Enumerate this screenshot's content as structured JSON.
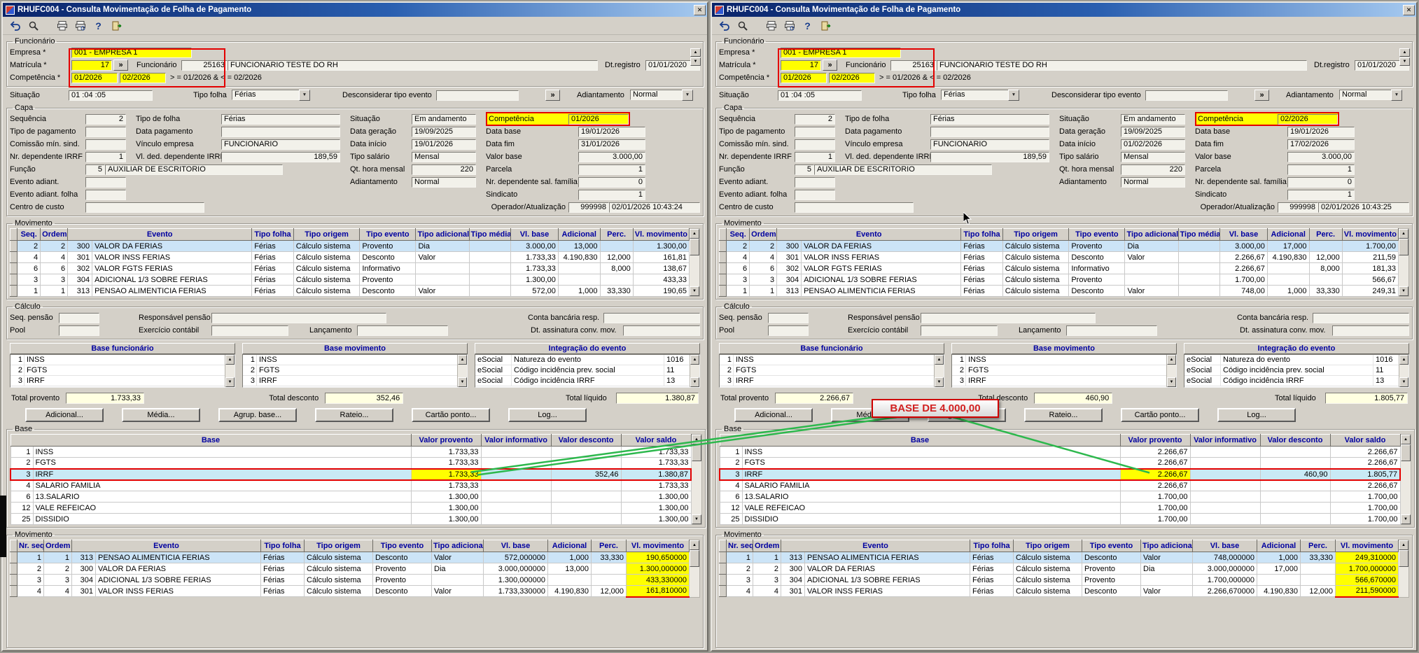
{
  "title": "RHUFC004 - Consulta Movimentação de Folha de Pagamento",
  "annotation": {
    "text": "BASE DE 4.000,00"
  },
  "icons": {
    "close": "✕",
    "dropdown": "▼",
    "more": "»",
    "up": "▲",
    "down": "▼",
    "help": "?"
  },
  "toolbar_icons": [
    "undo",
    "search",
    "print",
    "print-preview",
    "help",
    "exit"
  ],
  "labels": {
    "funcionario": "Funcionário",
    "empresa": "Empresa *",
    "matricula": "Matrícula *",
    "funcionario2": "Funcionário",
    "dt_registro": "Dt.registro",
    "competencia": "Competência *",
    "situacao": "Situação",
    "tipo_folha": "Tipo folha",
    "desconsiderar": "Desconsiderar tipo evento",
    "adiantamento": "Adiantamento",
    "capa": "Capa",
    "sequencia": "Sequência",
    "tipo_de_folha": "Tipo de folha",
    "competencia2": "Competência",
    "tipo_pagamento": "Tipo de pagamento",
    "data_pagamento": "Data pagamento",
    "data_geracao": "Data geração",
    "data_base": "Data base",
    "comissao": "Comissão mín. sind.",
    "vinculo_empresa": "Vínculo empresa",
    "data_inicio": "Data início",
    "data_fim": "Data fim",
    "nr_dep_irrf": "Nr. dependente IRRF",
    "vl_ded_irrf": "Vl. ded. dependente IRRF",
    "tipo_salario": "Tipo salário",
    "valor_base": "Valor base",
    "funcao": "Função",
    "qt_hora": "Qt. hora mensal",
    "parcela": "Parcela",
    "evento_adiant": "Evento adiant.",
    "nr_dep_sal": "Nr. dependente sal. família",
    "evento_adiant_folha": "Evento adiant. folha",
    "sindicato": "Sindicato",
    "centro_custo": "Centro de custo",
    "operador": "Operador/Atualização",
    "movimento": "Movimento",
    "mov_headers": [
      "Seq.",
      "Ordem",
      "Evento",
      "Tipo folha",
      "Tipo origem",
      "Tipo evento",
      "Tipo adicional",
      "Tipo média",
      "Vl. base",
      "Adicional",
      "Perc.",
      "Vl. movimento"
    ],
    "calculo": "Cálculo",
    "seq_pensao": "Seq. pensão",
    "resp_pensao": "Responsável pensão",
    "conta_bancaria": "Conta bancária resp.",
    "pool": "Pool",
    "exercicio": "Exercício contábil",
    "lancamento": "Lançamento",
    "dt_assinatura": "Dt. assinatura conv. mov.",
    "base_funcionario": "Base funcionário",
    "base_movimento": "Base movimento",
    "integracao": "Integração do evento",
    "total_provento": "Total provento",
    "total_desconto": "Total desconto",
    "total_liquido": "Total líquido",
    "action_buttons": [
      "Adicional...",
      "Média...",
      "Agrup. base...",
      "Rateio...",
      "Cartão ponto...",
      "Log..."
    ],
    "base": "Base",
    "base_headers": [
      "Base",
      "Valor provento",
      "Valor informativo",
      "Valor desconto",
      "Valor saldo"
    ],
    "mov2_headers": [
      "Nr. seq.",
      "Ordem",
      "Evento",
      "Tipo folha",
      "Tipo origem",
      "Tipo evento",
      "Tipo adicional",
      "Vl. base",
      "Adicional",
      "Perc.",
      "Vl. movimento"
    ]
  },
  "windows": [
    {
      "func": {
        "empresa": "001 - EMPRESA 1",
        "matricula": "17",
        "func_num": "25163",
        "func_nome": "FUNCIONARIO TESTE DO RH",
        "dt_registro": "01/01/2020",
        "comp_de": "01/2026",
        "comp_ate": "02/2026",
        "comp_hint": "> = 01/2026  & < = 02/2026",
        "situacao": "01 :04 :05",
        "tipo_folha": "Férias",
        "desconsiderar": "",
        "adiantamento": "Normal"
      },
      "capa": {
        "sequencia": "2",
        "tipo_folha": "Férias",
        "situacao": "Em andamento",
        "competencia": "01/2026",
        "tipo_pagamento": "",
        "data_pagamento": "",
        "data_geracao": "19/09/2025",
        "data_base": "19/01/2026",
        "comissao": "",
        "vinculo": "FUNCIONARIO",
        "data_inicio": "19/01/2026",
        "data_fim": "31/01/2026",
        "nr_dep_irrf": "1",
        "vl_ded_irrf": "189,59",
        "tipo_salario": "Mensal",
        "valor_base": "3.000,00",
        "funcao_num": "5",
        "funcao_nome": "AUXILIAR DE ESCRITORIO",
        "qt_hora": "220",
        "parcela": "1",
        "evento_adiant": "",
        "adiantamento": "Normal",
        "nr_dep_sal": "0",
        "evento_adiant_folha": "",
        "sindicato": "1",
        "centro_custo": "",
        "operador": "999998",
        "atualizacao": "02/01/2026 10:43:24"
      },
      "mov": {
        "rows": [
          {
            "sel": true,
            "seq": "2",
            "ordem": "2",
            "cod": "300",
            "nome": "VALOR DA FERIAS",
            "tfolha": "Férias",
            "torigem": "Cálculo sistema",
            "tevento": "Provento",
            "tadic": "Dia",
            "tmedia": "",
            "vbase": "3.000,00",
            "adic": "13,000",
            "perc": "",
            "vmov": "1.300,00"
          },
          {
            "sel": false,
            "seq": "4",
            "ordem": "4",
            "cod": "301",
            "nome": "VALOR INSS FERIAS",
            "tfolha": "Férias",
            "torigem": "Cálculo sistema",
            "tevento": "Desconto",
            "tadic": "Valor",
            "tmedia": "",
            "vbase": "1.733,33",
            "adic": "4.190,830",
            "perc": "12,000",
            "vmov": "161,81"
          },
          {
            "sel": false,
            "seq": "6",
            "ordem": "6",
            "cod": "302",
            "nome": "VALOR FGTS FERIAS",
            "tfolha": "Férias",
            "torigem": "Cálculo sistema",
            "tevento": "Informativo",
            "tadic": "",
            "tmedia": "",
            "vbase": "1.733,33",
            "adic": "",
            "perc": "8,000",
            "vmov": "138,67"
          },
          {
            "sel": false,
            "seq": "3",
            "ordem": "3",
            "cod": "304",
            "nome": "ADICIONAL 1/3 SOBRE FERIAS",
            "tfolha": "Férias",
            "torigem": "Cálculo sistema",
            "tevento": "Provento",
            "tadic": "",
            "tmedia": "",
            "vbase": "1.300,00",
            "adic": "",
            "perc": "",
            "vmov": "433,33"
          },
          {
            "sel": false,
            "seq": "1",
            "ordem": "1",
            "cod": "313",
            "nome": "PENSAO ALIMENTICIA FERIAS",
            "tfolha": "Férias",
            "torigem": "Cálculo sistema",
            "tevento": "Desconto",
            "tadic": "Valor",
            "tmedia": "",
            "vbase": "572,00",
            "adic": "1,000",
            "perc": "33,330",
            "vmov": "190,65"
          }
        ]
      },
      "calc": {
        "seq_pensao": "",
        "resp_pensao": "",
        "conta": "",
        "pool": "",
        "exercicio": "",
        "lancamento": "",
        "dt_assin": ""
      },
      "base_func": {
        "rows": [
          {
            "num": "1",
            "nome": "INSS"
          },
          {
            "num": "2",
            "nome": "FGTS"
          },
          {
            "num": "3",
            "nome": "IRRF"
          }
        ]
      },
      "base_mov": {
        "rows": [
          {
            "num": "1",
            "nome": "INSS"
          },
          {
            "num": "2",
            "nome": "FGTS"
          },
          {
            "num": "3",
            "nome": "IRRF"
          }
        ]
      },
      "integr": {
        "rows": [
          {
            "sis": "eSocial",
            "desc": "Natureza do evento",
            "val": "1016"
          },
          {
            "sis": "eSocial",
            "desc": "Código incidência prev. social",
            "val": "11"
          },
          {
            "sis": "eSocial",
            "desc": "Código incidência IRRF",
            "val": "13"
          }
        ]
      },
      "totais": {
        "provento": "1.733,33",
        "desconto": "352,46",
        "liquido": "1.380,87"
      },
      "base": {
        "rows": [
          {
            "hl": false,
            "num": "1",
            "nome": "INSS",
            "prov": "1.733,33",
            "info": "",
            "desc": "",
            "saldo": "1.733,33"
          },
          {
            "hl": false,
            "num": "2",
            "nome": "FGTS",
            "prov": "1.733,33",
            "info": "",
            "desc": "",
            "saldo": "1.733,33"
          },
          {
            "hl": true,
            "num": "3",
            "nome": "IRRF",
            "prov": "1.733,33",
            "info": "",
            "desc": "352,46",
            "saldo": "1.380,87"
          },
          {
            "hl": false,
            "num": "4",
            "nome": "SALARIO FAMILIA",
            "prov": "1.733,33",
            "info": "",
            "desc": "",
            "saldo": "1.733,33"
          },
          {
            "hl": false,
            "num": "6",
            "nome": "13.SALARIO",
            "prov": "1.300,00",
            "info": "",
            "desc": "",
            "saldo": "1.300,00"
          },
          {
            "hl": false,
            "num": "12",
            "nome": "VALE REFEICAO",
            "prov": "1.300,00",
            "info": "",
            "desc": "",
            "saldo": "1.300,00"
          },
          {
            "hl": false,
            "num": "25",
            "nome": "DISSIDIO",
            "prov": "1.300,00",
            "info": "",
            "desc": "",
            "saldo": "1.300,00"
          }
        ]
      },
      "mov2": {
        "rows": [
          {
            "sel": true,
            "nr": "1",
            "ordem": "1",
            "cod": "313",
            "nome": "PENSAO ALIMENTICIA FERIAS",
            "tfolha": "Férias",
            "torigem": "Cálculo sistema",
            "tevento": "Desconto",
            "tadic": "Valor",
            "vbase": "572,000000",
            "adic": "1,000",
            "perc": "33,330",
            "vmov": "190,650000"
          },
          {
            "sel": false,
            "nr": "2",
            "ordem": "2",
            "cod": "300",
            "nome": "VALOR DA FERIAS",
            "tfolha": "Férias",
            "torigem": "Cálculo sistema",
            "tevento": "Provento",
            "tadic": "Dia",
            "vbase": "3.000,000000",
            "adic": "13,000",
            "perc": "",
            "vmov": "1.300,000000"
          },
          {
            "sel": false,
            "nr": "3",
            "ordem": "3",
            "cod": "304",
            "nome": "ADICIONAL 1/3 SOBRE FERIAS",
            "tfolha": "Férias",
            "torigem": "Cálculo sistema",
            "tevento": "Provento",
            "tadic": "",
            "vbase": "1.300,000000",
            "adic": "",
            "perc": "",
            "vmov": "433,330000"
          },
          {
            "sel": false,
            "nr": "4",
            "ordem": "4",
            "cod": "301",
            "nome": "VALOR INSS FERIAS",
            "tfolha": "Férias",
            "torigem": "Cálculo sistema",
            "tevento": "Desconto",
            "tadic": "Valor",
            "vbase": "1.733,330000",
            "adic": "4.190,830",
            "perc": "12,000",
            "vmov": "161,810000"
          }
        ]
      }
    },
    {
      "func": {
        "empresa": "001 - EMPRESA 1",
        "matricula": "17",
        "func_num": "25163",
        "func_nome": "FUNCIONARIO TESTE DO RH",
        "dt_registro": "01/01/2020",
        "comp_de": "01/2026",
        "comp_ate": "02/2026",
        "comp_hint": "> = 01/2026  & < = 02/2026",
        "situacao": "01 :04 :05",
        "tipo_folha": "Férias",
        "desconsiderar": "",
        "adiantamento": "Normal"
      },
      "capa": {
        "sequencia": "2",
        "tipo_folha": "Férias",
        "situacao": "Em andamento",
        "competencia": "02/2026",
        "tipo_pagamento": "",
        "data_pagamento": "",
        "data_geracao": "19/09/2025",
        "data_base": "19/01/2026",
        "comissao": "",
        "vinculo": "FUNCIONARIO",
        "data_inicio": "01/02/2026",
        "data_fim": "17/02/2026",
        "nr_dep_irrf": "1",
        "vl_ded_irrf": "189,59",
        "tipo_salario": "Mensal",
        "valor_base": "3.000,00",
        "funcao_num": "5",
        "funcao_nome": "AUXILIAR DE ESCRITORIO",
        "qt_hora": "220",
        "parcela": "1",
        "evento_adiant": "",
        "adiantamento": "Normal",
        "nr_dep_sal": "0",
        "evento_adiant_folha": "",
        "sindicato": "1",
        "centro_custo": "",
        "operador": "999998",
        "atualizacao": "02/01/2026 10:43:25"
      },
      "mov": {
        "rows": [
          {
            "sel": true,
            "seq": "2",
            "ordem": "2",
            "cod": "300",
            "nome": "VALOR DA FERIAS",
            "tfolha": "Férias",
            "torigem": "Cálculo sistema",
            "tevento": "Provento",
            "tadic": "Dia",
            "tmedia": "",
            "vbase": "3.000,00",
            "adic": "17,000",
            "perc": "",
            "vmov": "1.700,00"
          },
          {
            "sel": false,
            "seq": "4",
            "ordem": "4",
            "cod": "301",
            "nome": "VALOR INSS FERIAS",
            "tfolha": "Férias",
            "torigem": "Cálculo sistema",
            "tevento": "Desconto",
            "tadic": "Valor",
            "tmedia": "",
            "vbase": "2.266,67",
            "adic": "4.190,830",
            "perc": "12,000",
            "vmov": "211,59"
          },
          {
            "sel": false,
            "seq": "6",
            "ordem": "6",
            "cod": "302",
            "nome": "VALOR FGTS FERIAS",
            "tfolha": "Férias",
            "torigem": "Cálculo sistema",
            "tevento": "Informativo",
            "tadic": "",
            "tmedia": "",
            "vbase": "2.266,67",
            "adic": "",
            "perc": "8,000",
            "vmov": "181,33"
          },
          {
            "sel": false,
            "seq": "3",
            "ordem": "3",
            "cod": "304",
            "nome": "ADICIONAL 1/3 SOBRE FERIAS",
            "tfolha": "Férias",
            "torigem": "Cálculo sistema",
            "tevento": "Provento",
            "tadic": "",
            "tmedia": "",
            "vbase": "1.700,00",
            "adic": "",
            "perc": "",
            "vmov": "566,67"
          },
          {
            "sel": false,
            "seq": "1",
            "ordem": "1",
            "cod": "313",
            "nome": "PENSAO ALIMENTICIA FERIAS",
            "tfolha": "Férias",
            "torigem": "Cálculo sistema",
            "tevento": "Desconto",
            "tadic": "Valor",
            "tmedia": "",
            "vbase": "748,00",
            "adic": "1,000",
            "perc": "33,330",
            "vmov": "249,31"
          }
        ]
      },
      "calc": {
        "seq_pensao": "",
        "resp_pensao": "",
        "conta": "",
        "pool": "",
        "exercicio": "",
        "lancamento": "",
        "dt_assin": ""
      },
      "base_func": {
        "rows": [
          {
            "num": "1",
            "nome": "INSS"
          },
          {
            "num": "2",
            "nome": "FGTS"
          },
          {
            "num": "3",
            "nome": "IRRF"
          }
        ]
      },
      "base_mov": {
        "rows": [
          {
            "num": "1",
            "nome": "INSS"
          },
          {
            "num": "2",
            "nome": "FGTS"
          },
          {
            "num": "3",
            "nome": "IRRF"
          }
        ]
      },
      "integr": {
        "rows": [
          {
            "sis": "eSocial",
            "desc": "Natureza do evento",
            "val": "1016"
          },
          {
            "sis": "eSocial",
            "desc": "Código incidência prev. social",
            "val": "11"
          },
          {
            "sis": "eSocial",
            "desc": "Código incidência IRRF",
            "val": "13"
          }
        ]
      },
      "totais": {
        "provento": "2.266,67",
        "desconto": "460,90",
        "liquido": "1.805,77"
      },
      "base": {
        "rows": [
          {
            "hl": false,
            "num": "1",
            "nome": "INSS",
            "prov": "2.266,67",
            "info": "",
            "desc": "",
            "saldo": "2.266,67"
          },
          {
            "hl": false,
            "num": "2",
            "nome": "FGTS",
            "prov": "2.266,67",
            "info": "",
            "desc": "",
            "saldo": "2.266,67"
          },
          {
            "hl": true,
            "num": "3",
            "nome": "IRRF",
            "prov": "2.266,67",
            "info": "",
            "desc": "460,90",
            "saldo": "1.805,77"
          },
          {
            "hl": false,
            "num": "4",
            "nome": "SALARIO FAMILIA",
            "prov": "2.266,67",
            "info": "",
            "desc": "",
            "saldo": "2.266,67"
          },
          {
            "hl": false,
            "num": "6",
            "nome": "13.SALARIO",
            "prov": "1.700,00",
            "info": "",
            "desc": "",
            "saldo": "1.700,00"
          },
          {
            "hl": false,
            "num": "12",
            "nome": "VALE REFEICAO",
            "prov": "1.700,00",
            "info": "",
            "desc": "",
            "saldo": "1.700,00"
          },
          {
            "hl": false,
            "num": "25",
            "nome": "DISSIDIO",
            "prov": "1.700,00",
            "info": "",
            "desc": "",
            "saldo": "1.700,00"
          }
        ]
      },
      "mov2": {
        "rows": [
          {
            "sel": true,
            "nr": "1",
            "ordem": "1",
            "cod": "313",
            "nome": "PENSAO ALIMENTICIA FERIAS",
            "tfolha": "Férias",
            "torigem": "Cálculo sistema",
            "tevento": "Desconto",
            "tadic": "Valor",
            "vbase": "748,000000",
            "adic": "1,000",
            "perc": "33,330",
            "vmov": "249,310000"
          },
          {
            "sel": false,
            "nr": "2",
            "ordem": "2",
            "cod": "300",
            "nome": "VALOR DA FERIAS",
            "tfolha": "Férias",
            "torigem": "Cálculo sistema",
            "tevento": "Provento",
            "tadic": "Dia",
            "vbase": "3.000,000000",
            "adic": "17,000",
            "perc": "",
            "vmov": "1.700,000000"
          },
          {
            "sel": false,
            "nr": "3",
            "ordem": "3",
            "cod": "304",
            "nome": "ADICIONAL 1/3 SOBRE FERIAS",
            "tfolha": "Férias",
            "torigem": "Cálculo sistema",
            "tevento": "Provento",
            "tadic": "",
            "vbase": "1.700,000000",
            "adic": "",
            "perc": "",
            "vmov": "566,670000"
          },
          {
            "sel": false,
            "nr": "4",
            "ordem": "4",
            "cod": "301",
            "nome": "VALOR INSS FERIAS",
            "tfolha": "Férias",
            "torigem": "Cálculo sistema",
            "tevento": "Desconto",
            "tadic": "Valor",
            "vbase": "2.266,670000",
            "adic": "4.190,830",
            "perc": "12,000",
            "vmov": "211,590000"
          }
        ]
      }
    }
  ]
}
